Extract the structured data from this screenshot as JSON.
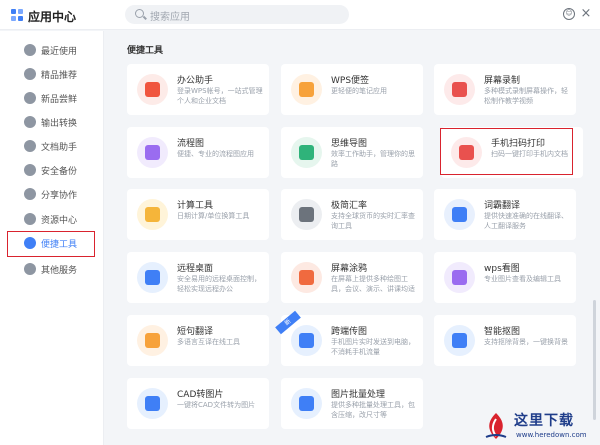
{
  "app": {
    "title": "应用中心",
    "feedback_icon": "smile-icon",
    "close_glyph": "×"
  },
  "search": {
    "placeholder": "搜索应用"
  },
  "sidebar": {
    "items": [
      {
        "label": "最近使用",
        "icon": "heart-icon"
      },
      {
        "label": "精品推荐",
        "icon": "diamond-icon"
      },
      {
        "label": "新品尝鲜",
        "icon": "gift-icon"
      },
      {
        "label": "输出转换",
        "icon": "convert-icon"
      },
      {
        "label": "文档助手",
        "icon": "document-icon"
      },
      {
        "label": "安全备份",
        "icon": "shield-icon"
      },
      {
        "label": "分享协作",
        "icon": "share-icon"
      },
      {
        "label": "资源中心",
        "icon": "resource-icon"
      },
      {
        "label": "便捷工具",
        "icon": "tool-icon",
        "active": true
      },
      {
        "label": "其他服务",
        "icon": "more-icon"
      }
    ]
  },
  "section": {
    "title": "便捷工具"
  },
  "cards": [
    {
      "name": "办公助手",
      "desc": "登录WPS帐号，一站式管理个人和企业文档",
      "bg": "#fdebe8",
      "fg": "#f0563f"
    },
    {
      "name": "WPS便签",
      "desc": "更轻便的笔记应用",
      "bg": "#fff1e2",
      "fg": "#f7a23b"
    },
    {
      "name": "屏幕录制",
      "desc": "多种模式录制屏幕操作，轻松制作教学视频",
      "bg": "#fdeaea",
      "fg": "#e9514e"
    },
    {
      "name": "流程图",
      "desc": "便捷、专业的流程图应用",
      "bg": "#f1ebfd",
      "fg": "#9a6cf0"
    },
    {
      "name": "思维导图",
      "desc": "效率工作助手，管理你的思路",
      "bg": "#e6f6ee",
      "fg": "#2fb37a"
    },
    {
      "name": "手机扫码打印",
      "desc": "扫码一键打印手机内文档",
      "bg": "#fdeaea",
      "fg": "#e9514e"
    },
    {
      "name": "计算工具",
      "desc": "日期计算/单位换算工具",
      "bg": "#fff4d9",
      "fg": "#f5b53a"
    },
    {
      "name": "极简汇率",
      "desc": "支持全球货币的实时汇率查询工具",
      "bg": "#eceef1",
      "fg": "#6c737c"
    },
    {
      "name": "词霸翻译",
      "desc": "提供快速准确的在线翻译、人工翻译服务",
      "bg": "#e8f0fd",
      "fg": "#3f7ff6"
    },
    {
      "name": "远程桌面",
      "desc": "安全易用的远程桌面控制，轻松实现远程办公",
      "bg": "#e6f0fe",
      "fg": "#3f7ff6"
    },
    {
      "name": "屏幕涂鸦",
      "desc": "在屏幕上提供多种绘图工具，会议、演示、讲课均适用",
      "bg": "#fde9e2",
      "fg": "#f06a3f"
    },
    {
      "name": "wps看图",
      "desc": "专业图片查看及编辑工具",
      "bg": "#f1ebfd",
      "fg": "#9a6cf0"
    },
    {
      "name": "短句翻译",
      "desc": "多语言互译在线工具",
      "bg": "#fff1e2",
      "fg": "#f7a23b"
    },
    {
      "name": "跨端传图",
      "desc": "手机图片实时发送到电脑，不消耗手机流量",
      "bg": "#e6f0fe",
      "fg": "#3f7ff6",
      "badge": "新"
    },
    {
      "name": "智能抠图",
      "desc": "支持抠除背景，一键换背景",
      "bg": "#e6f0fe",
      "fg": "#3f7ff6"
    },
    {
      "name": "CAD转图片",
      "desc": "一键将CAD文件转为图片",
      "bg": "#e6f0fe",
      "fg": "#3f7ff6"
    },
    {
      "name": "图片批量处理",
      "desc": "提供多种批量处理工具，包含压缩，改尺寸等",
      "bg": "#e6f0fe",
      "fg": "#3f7ff6"
    }
  ],
  "watermark": {
    "title": "这里下载",
    "url": "www.heredown.com"
  }
}
